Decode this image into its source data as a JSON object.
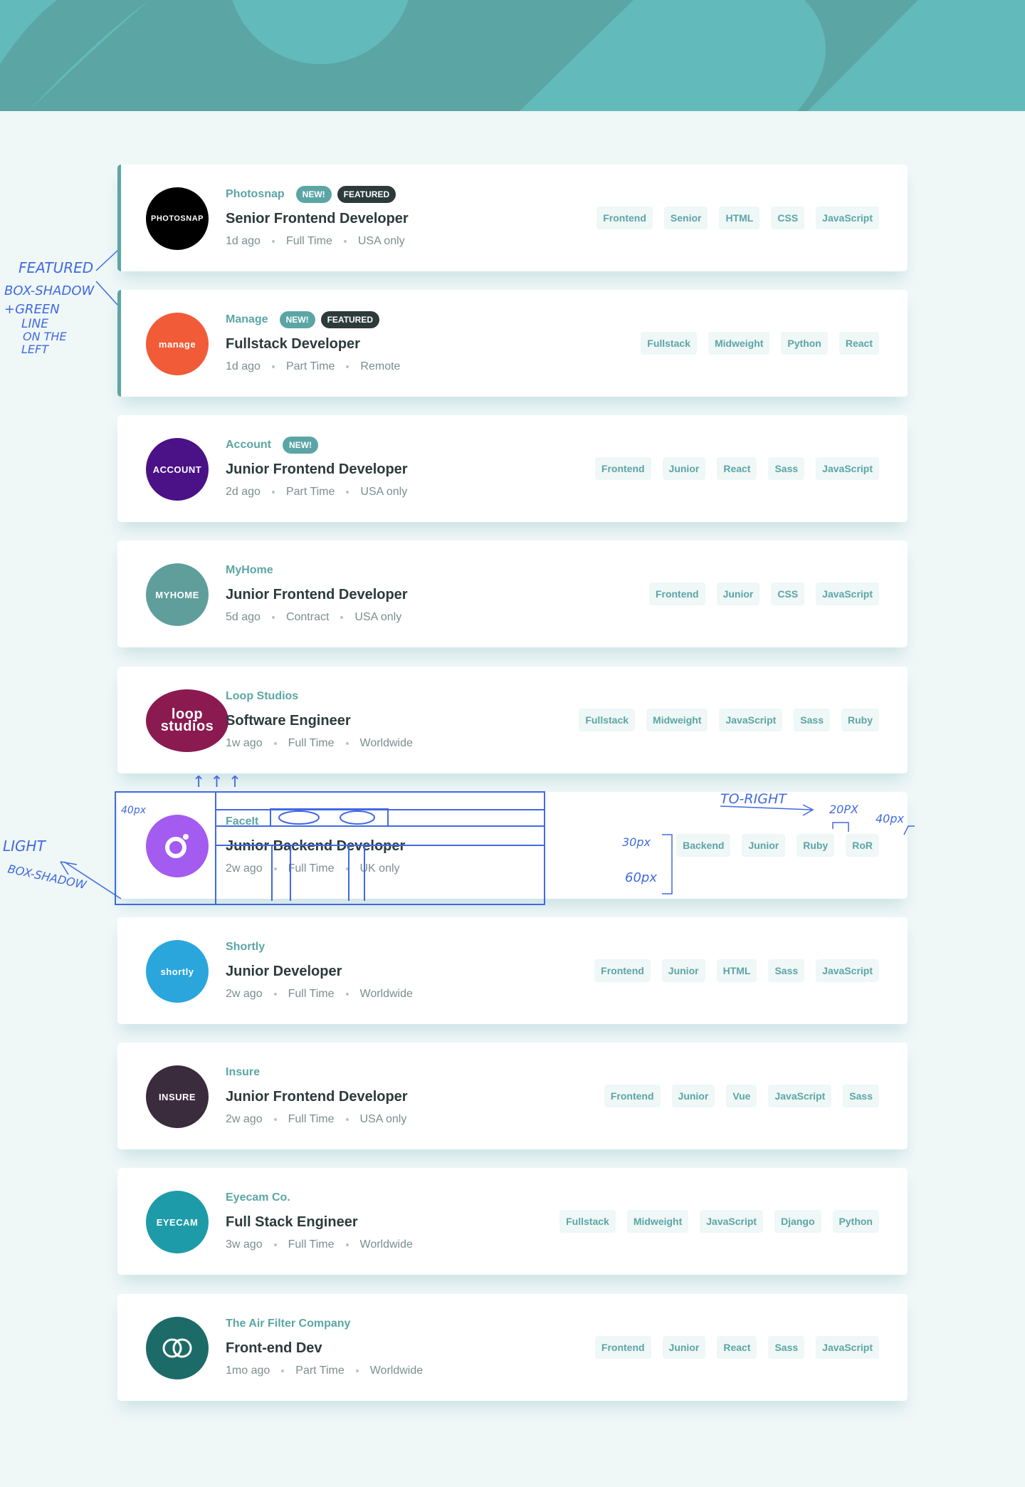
{
  "header": {
    "bg_color": "#5ca5a5"
  },
  "listings": [
    {
      "company": "Photosnap",
      "logo_text": "PHOTOSNAP",
      "logo_color": "#000000",
      "new": "NEW!",
      "featured": "FEATURED",
      "position": "Senior Frontend Developer",
      "posted": "1d ago",
      "contract": "Full Time",
      "location": "USA only",
      "tags": [
        "Frontend",
        "Senior",
        "HTML",
        "CSS",
        "JavaScript"
      ]
    },
    {
      "company": "Manage",
      "logo_text": "manage",
      "logo_color": "#f15b38",
      "new": "NEW!",
      "featured": "FEATURED",
      "position": "Fullstack Developer",
      "posted": "1d ago",
      "contract": "Part Time",
      "location": "Remote",
      "tags": [
        "Fullstack",
        "Midweight",
        "Python",
        "React"
      ]
    },
    {
      "company": "Account",
      "logo_text": "ACCOUNT",
      "logo_color": "#4b1186",
      "new": "NEW!",
      "featured": "",
      "position": "Junior Frontend Developer",
      "posted": "2d ago",
      "contract": "Part Time",
      "location": "USA only",
      "tags": [
        "Frontend",
        "Junior",
        "React",
        "Sass",
        "JavaScript"
      ]
    },
    {
      "company": "MyHome",
      "logo_text": "MYHOME",
      "logo_color": "#5f9e9b",
      "new": "",
      "featured": "",
      "position": "Junior Frontend Developer",
      "posted": "5d ago",
      "contract": "Contract",
      "location": "USA only",
      "tags": [
        "Frontend",
        "Junior",
        "CSS",
        "JavaScript"
      ]
    },
    {
      "company": "Loop Studios",
      "logo_text": "loop studios",
      "logo_color": "#8a1a50",
      "new": "",
      "featured": "",
      "position": "Software Engineer",
      "posted": "1w ago",
      "contract": "Full Time",
      "location": "Worldwide",
      "tags": [
        "Fullstack",
        "Midweight",
        "JavaScript",
        "Sass",
        "Ruby"
      ]
    },
    {
      "company": "FaceIt",
      "logo_text": "",
      "logo_color": "#a35bf0",
      "new": "",
      "featured": "",
      "position": "Junior Backend Developer",
      "posted": "2w ago",
      "contract": "Full Time",
      "location": "UK only",
      "tags": [
        "Backend",
        "Junior",
        "Ruby",
        "RoR"
      ]
    },
    {
      "company": "Shortly",
      "logo_text": "shortly",
      "logo_color": "#2aa6dd",
      "new": "",
      "featured": "",
      "position": "Junior Developer",
      "posted": "2w ago",
      "contract": "Full Time",
      "location": "Worldwide",
      "tags": [
        "Frontend",
        "Junior",
        "HTML",
        "Sass",
        "JavaScript"
      ]
    },
    {
      "company": "Insure",
      "logo_text": "INSURE",
      "logo_color": "#3a2b3d",
      "new": "",
      "featured": "",
      "position": "Junior Frontend Developer",
      "posted": "2w ago",
      "contract": "Full Time",
      "location": "USA only",
      "tags": [
        "Frontend",
        "Junior",
        "Vue",
        "JavaScript",
        "Sass"
      ]
    },
    {
      "company": "Eyecam Co.",
      "logo_text": "EYECAM",
      "logo_color": "#1e9ba8",
      "new": "",
      "featured": "",
      "position": "Full Stack Engineer",
      "posted": "3w ago",
      "contract": "Full Time",
      "location": "Worldwide",
      "tags": [
        "Fullstack",
        "Midweight",
        "JavaScript",
        "Django",
        "Python"
      ]
    },
    {
      "company": "The Air Filter Company",
      "logo_text": "",
      "logo_color": "#1d6b68",
      "new": "",
      "featured": "",
      "position": "Front-end Dev",
      "posted": "1mo ago",
      "contract": "Part Time",
      "location": "Worldwide",
      "tags": [
        "Frontend",
        "Junior",
        "React",
        "Sass",
        "JavaScript"
      ]
    }
  ],
  "annotations": {
    "featured_note": [
      "FEATURED",
      "BOX-SHADOW",
      "+GREEN",
      "LINE",
      "ON THE",
      "LEFT"
    ],
    "light_note": [
      "LIGHT",
      "BOX-SHADOW"
    ],
    "to_right": "TO-RIGHT",
    "px_20": "20PX",
    "px_40": "40px",
    "px_40b": "40px",
    "px_30": "30px",
    "px_60": "60px",
    "arrow_marks": "↑ ↑ ↑"
  }
}
